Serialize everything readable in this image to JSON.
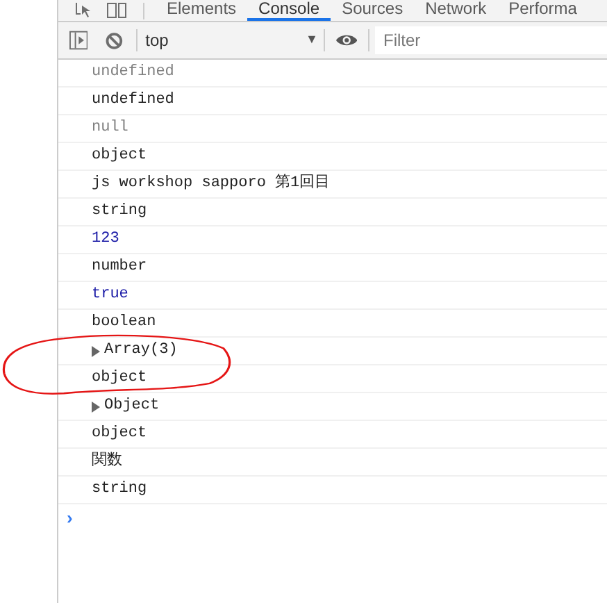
{
  "tabs": [
    {
      "label": "Elements",
      "selected": false
    },
    {
      "label": "Console",
      "selected": true
    },
    {
      "label": "Sources",
      "selected": false
    },
    {
      "label": "Network",
      "selected": false
    },
    {
      "label": "Performa",
      "selected": false
    }
  ],
  "toolbar": {
    "context": "top",
    "context_caret": "▼",
    "filter": {
      "placeholder": "Filter"
    }
  },
  "rows": [
    {
      "kind": "muted",
      "text": "undefined"
    },
    {
      "kind": "text",
      "text": "undefined"
    },
    {
      "kind": "muted",
      "text": "null"
    },
    {
      "kind": "text",
      "text": "object"
    },
    {
      "kind": "text",
      "text": "js workshop sapporo 第1回目"
    },
    {
      "kind": "text",
      "text": "string"
    },
    {
      "kind": "number",
      "text": "123"
    },
    {
      "kind": "text",
      "text": "number"
    },
    {
      "kind": "number",
      "text": "true"
    },
    {
      "kind": "text",
      "text": "boolean"
    },
    {
      "kind": "expandable",
      "text": "Array(3)"
    },
    {
      "kind": "text",
      "text": "object"
    },
    {
      "kind": "expandable",
      "text": "Object"
    },
    {
      "kind": "text",
      "text": "object"
    },
    {
      "kind": "text",
      "text": "関数"
    },
    {
      "kind": "text",
      "text": "string"
    }
  ],
  "prompt": "›"
}
